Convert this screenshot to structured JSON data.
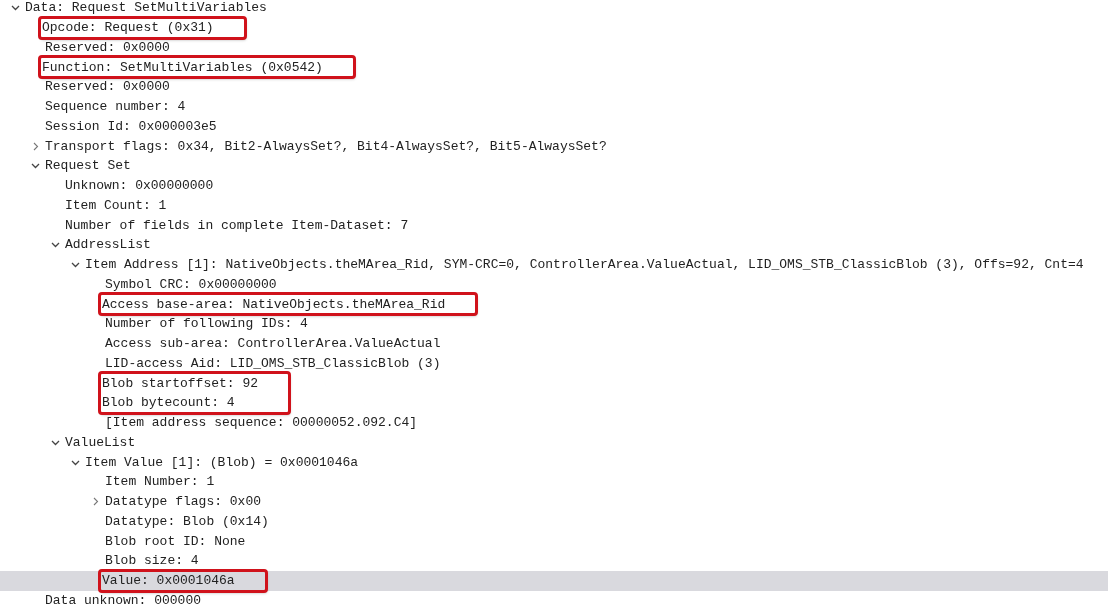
{
  "tree": [
    {
      "label": "Data: Request SetMultiVariables",
      "expanded": true,
      "selected": false,
      "marked": false,
      "children": [
        {
          "label": "Opcode: Request (0x31)",
          "selected": false,
          "marked": true
        },
        {
          "label": "Reserved: 0x0000",
          "selected": false,
          "marked": false
        },
        {
          "label": "Function: SetMultiVariables (0x0542)",
          "selected": false,
          "marked": true
        },
        {
          "label": "Reserved: 0x0000",
          "selected": false,
          "marked": false
        },
        {
          "label": "Sequence number: 4",
          "selected": false,
          "marked": false
        },
        {
          "label": "Session Id: 0x000003e5",
          "selected": false,
          "marked": false
        },
        {
          "label": "Transport flags: 0x34, Bit2-AlwaysSet?, Bit4-AlwaysSet?, Bit5-AlwaysSet?",
          "expanded": false,
          "selected": false,
          "marked": false
        },
        {
          "label": "Request Set",
          "expanded": true,
          "selected": false,
          "marked": false,
          "children": [
            {
              "label": "Unknown: 0x00000000",
              "selected": false,
              "marked": false
            },
            {
              "label": "Item Count: 1",
              "selected": false,
              "marked": false
            },
            {
              "label": "Number of fields in complete Item-Dataset: 7",
              "selected": false,
              "marked": false
            },
            {
              "label": "AddressList",
              "expanded": true,
              "selected": false,
              "marked": false,
              "children": [
                {
                  "label": "Item Address [1]: NativeObjects.theMArea_Rid, SYM-CRC=0, ControllerArea.ValueActual, LID_OMS_STB_ClassicBlob (3), Offs=92, Cnt=4",
                  "expanded": true,
                  "selected": false,
                  "marked": false,
                  "children": [
                    {
                      "label": "Symbol CRC: 0x00000000",
                      "selected": false,
                      "marked": false
                    },
                    {
                      "label": "Access base-area: NativeObjects.theMArea_Rid",
                      "selected": false,
                      "marked": true
                    },
                    {
                      "label": "Number of following IDs: 4",
                      "selected": false,
                      "marked": false
                    },
                    {
                      "label": "Access sub-area: ControllerArea.ValueActual",
                      "selected": false,
                      "marked": false
                    },
                    {
                      "label": "LID-access Aid: LID_OMS_STB_ClassicBlob (3)",
                      "selected": false,
                      "marked": false
                    },
                    {
                      "label": "Blob startoffset: 92",
                      "selected": false,
                      "marked": true
                    },
                    {
                      "label": "Blob bytecount: 4",
                      "selected": false,
                      "marked": true
                    },
                    {
                      "label": "[Item address sequence: 00000052.092.C4]",
                      "selected": false,
                      "marked": false
                    }
                  ]
                }
              ]
            },
            {
              "label": "ValueList",
              "expanded": true,
              "selected": false,
              "marked": false,
              "children": [
                {
                  "label": "Item Value [1]: (Blob) = 0x0001046a",
                  "expanded": true,
                  "selected": false,
                  "marked": false,
                  "children": [
                    {
                      "label": "Item Number: 1",
                      "selected": false,
                      "marked": false
                    },
                    {
                      "label": "Datatype flags: 0x00",
                      "expanded": false,
                      "selected": false,
                      "marked": false
                    },
                    {
                      "label": "Datatype: Blob (0x14)",
                      "selected": false,
                      "marked": false
                    },
                    {
                      "label": "Blob root ID: None",
                      "selected": false,
                      "marked": false
                    },
                    {
                      "label": "Blob size: 4",
                      "selected": false,
                      "marked": false
                    },
                    {
                      "label": "Value: 0x0001046a",
                      "selected": true,
                      "marked": true
                    }
                  ]
                }
              ]
            }
          ]
        },
        {
          "label": "Data unknown: 000000",
          "selected": false,
          "marked": false
        }
      ]
    }
  ]
}
